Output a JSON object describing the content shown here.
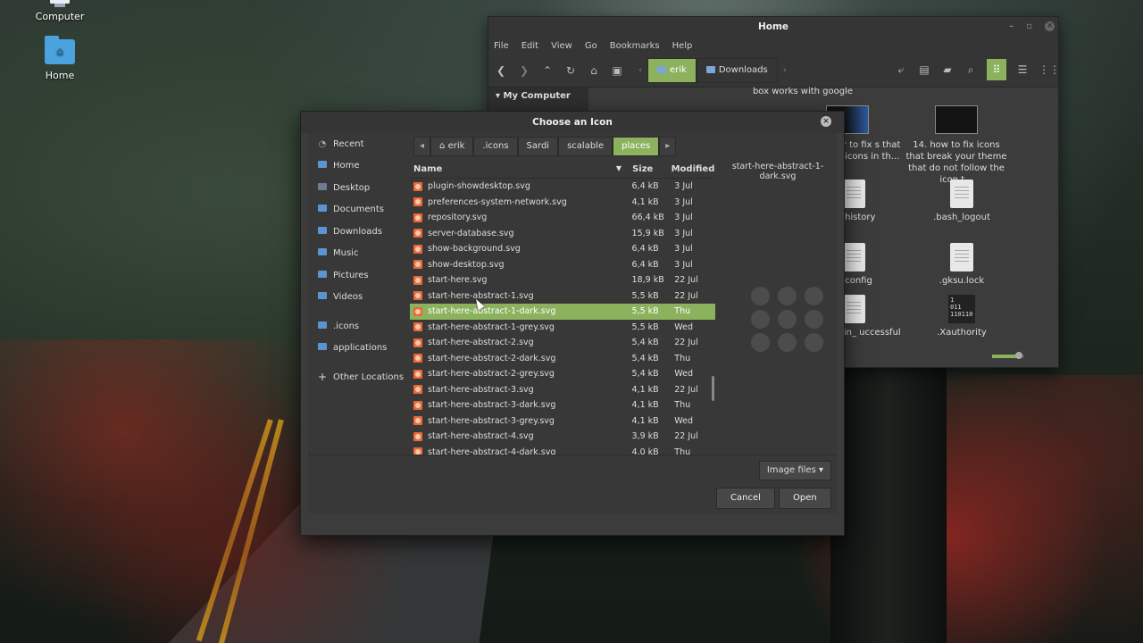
{
  "desktop": {
    "icons": [
      {
        "label": "Computer"
      },
      {
        "label": "Home"
      }
    ]
  },
  "file_manager": {
    "title": "Home",
    "menu": [
      "File",
      "Edit",
      "View",
      "Go",
      "Bookmarks",
      "Help"
    ],
    "breadcrumbs": [
      "erik",
      "Downloads"
    ],
    "sidebar_section": "My Computer",
    "items": [
      {
        "label": "box works with google",
        "icon": "text"
      },
      {
        "label": "codefixer to fix s that have ed icons in th...",
        "icon": "video-thumbnail"
      },
      {
        "label": "14. how to fix icons that break your theme that do not follow the icon t...",
        "icon": "video-thumbnail"
      },
      {
        "label": "sh_history",
        "icon": "document"
      },
      {
        "label": ".bash_logout",
        "icon": "document"
      },
      {
        "label": "gitconfig",
        "icon": "document"
      },
      {
        "label": ".gksu.lock",
        "icon": "document"
      },
      {
        "label": "_as_admin_ uccessful",
        "icon": "document"
      },
      {
        "label": ".Xauthority",
        "icon": "binary"
      }
    ],
    "binary_icon_text": "1\n011\n110110"
  },
  "dialog": {
    "title": "Choose an Icon",
    "places": [
      {
        "label": "Recent",
        "icon": "clock-icon"
      },
      {
        "label": "Home",
        "icon": "folder-icon"
      },
      {
        "label": "Desktop",
        "icon": "folder-icon"
      },
      {
        "label": "Documents",
        "icon": "folder-icon"
      },
      {
        "label": "Downloads",
        "icon": "folder-icon"
      },
      {
        "label": "Music",
        "icon": "folder-icon"
      },
      {
        "label": "Pictures",
        "icon": "folder-icon"
      },
      {
        "label": "Videos",
        "icon": "folder-icon"
      },
      {
        "label": ".icons",
        "icon": "folder-icon"
      },
      {
        "label": "applications",
        "icon": "folder-icon"
      },
      {
        "label": "Other Locations",
        "icon": "plus-icon"
      }
    ],
    "path": [
      "erik",
      ".icons",
      "Sardi",
      "scalable",
      "places"
    ],
    "columns": {
      "name": "Name",
      "size": "Size",
      "modified": "Modified"
    },
    "files": [
      {
        "name": "plugin-showdesktop.svg",
        "size": "6,4 kB",
        "modified": "3 Jul"
      },
      {
        "name": "preferences-system-network.svg",
        "size": "4,1 kB",
        "modified": "3 Jul"
      },
      {
        "name": "repository.svg",
        "size": "66,4 kB",
        "modified": "3 Jul"
      },
      {
        "name": "server-database.svg",
        "size": "15,9 kB",
        "modified": "3 Jul"
      },
      {
        "name": "show-background.svg",
        "size": "6,4 kB",
        "modified": "3 Jul"
      },
      {
        "name": "show-desktop.svg",
        "size": "6,4 kB",
        "modified": "3 Jul"
      },
      {
        "name": "start-here.svg",
        "size": "18,9 kB",
        "modified": "22 Jul"
      },
      {
        "name": "start-here-abstract-1.svg",
        "size": "5,5 kB",
        "modified": "22 Jul"
      },
      {
        "name": "start-here-abstract-1-dark.svg",
        "size": "5,5 kB",
        "modified": "Thu",
        "selected": true
      },
      {
        "name": "start-here-abstract-1-grey.svg",
        "size": "5,5 kB",
        "modified": "Wed"
      },
      {
        "name": "start-here-abstract-2.svg",
        "size": "5,4 kB",
        "modified": "22 Jul"
      },
      {
        "name": "start-here-abstract-2-dark.svg",
        "size": "5,4 kB",
        "modified": "Thu"
      },
      {
        "name": "start-here-abstract-2-grey.svg",
        "size": "5,4 kB",
        "modified": "Wed"
      },
      {
        "name": "start-here-abstract-3.svg",
        "size": "4,1 kB",
        "modified": "22 Jul"
      },
      {
        "name": "start-here-abstract-3-dark.svg",
        "size": "4,1 kB",
        "modified": "Thu"
      },
      {
        "name": "start-here-abstract-3-grey.svg",
        "size": "4,1 kB",
        "modified": "Wed"
      },
      {
        "name": "start-here-abstract-4.svg",
        "size": "3,9 kB",
        "modified": "22 Jul"
      },
      {
        "name": "start-here-abstract-4-dark.svg",
        "size": "4,0 kB",
        "modified": "Thu"
      }
    ],
    "preview_name": "start-here-abstract-1-dark.svg",
    "filter": "Image files",
    "cancel_label": "Cancel",
    "open_label": "Open"
  },
  "colors": {
    "accent": "#8cb25e",
    "file_icon": "#e9693a"
  }
}
